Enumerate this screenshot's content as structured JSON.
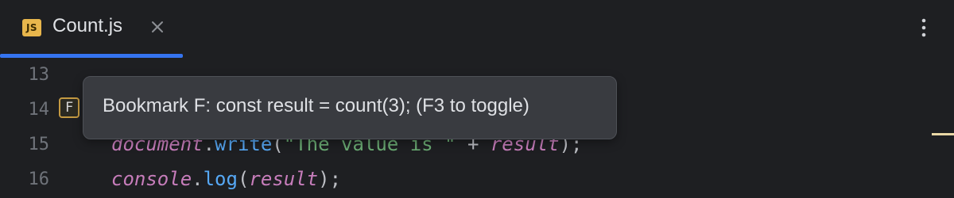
{
  "tab": {
    "file_icon": "JS",
    "filename": "Count.js",
    "close_icon": "close-icon",
    "active_color": "#3574f0"
  },
  "toolbar": {
    "more_icon": "more-vertical-icon"
  },
  "gutter": {
    "line_numbers": [
      "13",
      "14",
      "15",
      "16"
    ],
    "bookmark_letter": "F"
  },
  "code": {
    "line15": {
      "obj": "document",
      "dot": ".",
      "method": "write",
      "open": "(",
      "string": "\"The value is \"",
      "plus": " + ",
      "var": "result",
      "close": ");"
    },
    "line16": {
      "obj": "console",
      "dot": ".",
      "method": "log",
      "open": "(",
      "var": "result",
      "close": ");"
    }
  },
  "tooltip": {
    "text": "Bookmark F: const result = count(3); (F3 to toggle)"
  }
}
